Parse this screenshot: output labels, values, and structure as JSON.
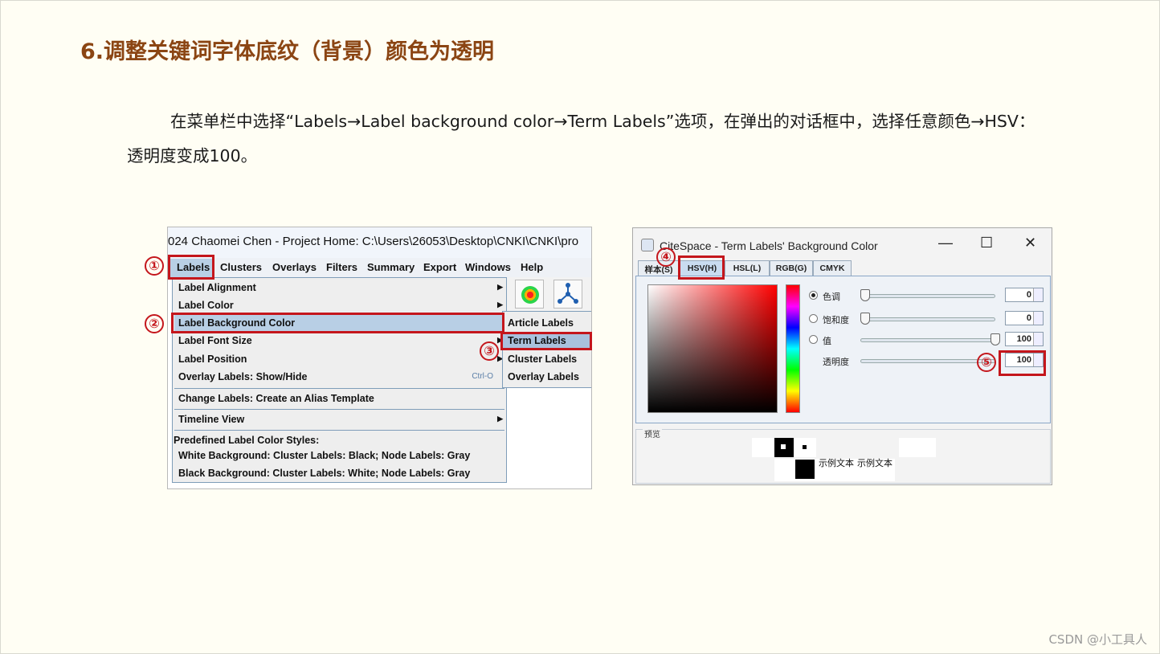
{
  "heading": "6.调整关键词字体底纹（背景）颜色为透明",
  "paragraph": {
    "line1": "在菜单栏中选择“Labels→Label background color→Term Labels”选项，在弹出的对话框中，选择任意颜色→HSV：",
    "line2": "透明度变成100。"
  },
  "watermark": "CSDN @小工具人",
  "left_screenshot": {
    "title": "024 Chaomei Chen - Project Home: C:\\Users\\26053\\Desktop\\CNKI\\CNKI\\pro",
    "menu": [
      "Labels",
      "Clusters",
      "Overlays",
      "Filters",
      "Summary",
      "Export",
      "Windows",
      "Help"
    ],
    "dropdown": {
      "items": [
        {
          "label": "Label Alignment",
          "arrow": "▶"
        },
        {
          "label": "Label Color",
          "arrow": "▶"
        },
        {
          "label": "Label Background Color",
          "arrow": "▶"
        },
        {
          "label": "Label Font Size",
          "arrow": "▶"
        },
        {
          "label": "Label Position",
          "arrow": "▶"
        },
        {
          "label": "Overlay Labels: Show/Hide",
          "hotkey": "Ctrl-O"
        }
      ],
      "alias": "Change Labels: Create an Alias Template",
      "timeline": "Timeline View",
      "timeline_arrow": "▶",
      "predefined_header": "Predefined Label Color Styles:",
      "style_white": "White Background: Cluster Labels: Black; Node Labels: Gray",
      "style_black": "Black Background: Cluster Labels: White; Node Labels: Gray"
    },
    "submenu": [
      "Article Labels",
      "Term Labels",
      "Cluster Labels",
      "Overlay Labels"
    ]
  },
  "badges": [
    "①",
    "②",
    "③",
    "④",
    "⑤"
  ],
  "right_screenshot": {
    "title": "CiteSpace - Term Labels' Background Color",
    "window_controls": [
      "—",
      "☐",
      "✕"
    ],
    "tabs": [
      "样本(S)",
      "HSV(H)",
      "HSL(L)",
      "RGB(G)",
      "CMYK"
    ],
    "hsv": [
      {
        "label": "色调",
        "value": "0",
        "slider": 0
      },
      {
        "label": "饱和度",
        "value": "0",
        "slider": 0
      },
      {
        "label": "值",
        "value": "100",
        "slider": 1
      },
      {
        "label": "透明度",
        "value": "100",
        "slider": 1
      }
    ],
    "preview_label": "预览",
    "preview_text": [
      "示例文本",
      "示例文本"
    ]
  },
  "colors": {
    "heading": "#8b4513",
    "badge": "#c4161c",
    "highlight": "#b8cfe5",
    "background": "#fffef4"
  }
}
